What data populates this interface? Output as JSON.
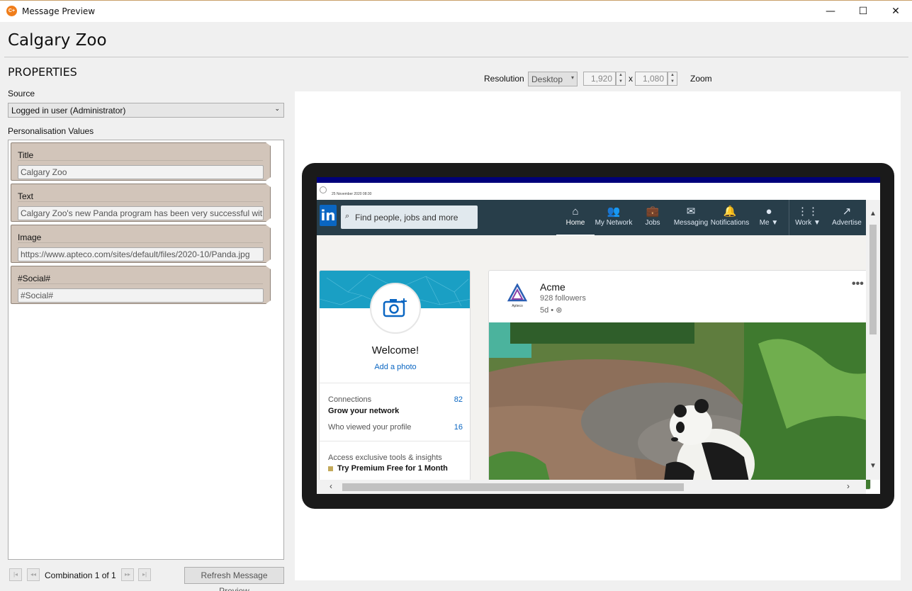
{
  "window": {
    "title": "Message Preview",
    "minimize": "—",
    "maximize": "☐",
    "close": "✕",
    "app_icon_text": "C+"
  },
  "page_title": "Calgary Zoo",
  "properties": {
    "heading": "PROPERTIES",
    "source_label": "Source",
    "source_value": "Logged in user (Administrator)",
    "personalisation_label": "Personalisation Values",
    "items": [
      {
        "title": "Title",
        "value": "Calgary Zoo"
      },
      {
        "title": "Text",
        "value": "Calgary Zoo's new Panda program has been very successful with"
      },
      {
        "title": "Image",
        "value": "https://www.apteco.com/sites/default/files/2020-10/Panda.jpg"
      },
      {
        "title": "#Social#",
        "value": "#Social#"
      }
    ]
  },
  "combination": {
    "text": "Combination 1 of 1",
    "first": "|◂",
    "prev": "◂◂",
    "next": "▸▸",
    "last": "▸|"
  },
  "refresh_button": "Refresh Message Preview",
  "resolution": {
    "label": "Resolution",
    "device": "Desktop",
    "width": "1,920",
    "height": "1,080",
    "x": "x",
    "zoom_label": "Zoom"
  },
  "preview": {
    "date": "25 November 2020 08:30",
    "linkedin": {
      "logo": "in",
      "search_placeholder": "Find people, jobs and more",
      "nav": [
        {
          "label": "Home",
          "icon": "⌂"
        },
        {
          "label": "My Network",
          "icon": "👥"
        },
        {
          "label": "Jobs",
          "icon": "💼"
        },
        {
          "label": "Messaging",
          "icon": "✉"
        },
        {
          "label": "Notifications",
          "icon": "🔔"
        },
        {
          "label": "Me ▼",
          "icon": "●"
        },
        {
          "label": "Work ▼",
          "icon": "⋮⋮"
        },
        {
          "label": "Advertise",
          "icon": "↗"
        }
      ],
      "profile": {
        "welcome": "Welcome!",
        "add_photo": "Add a photo",
        "connections_label": "Connections",
        "connections_value": "82",
        "grow": "Grow your network",
        "viewed_label": "Who viewed your profile",
        "viewed_value": "16",
        "exclusive": "Access exclusive tools & insights",
        "premium": "Try Premium Free for 1 Month"
      },
      "post": {
        "company": "Acme",
        "logo_text": "Apteco",
        "followers": "928 followers",
        "time": "5d • ",
        "menu": "•••"
      }
    }
  }
}
